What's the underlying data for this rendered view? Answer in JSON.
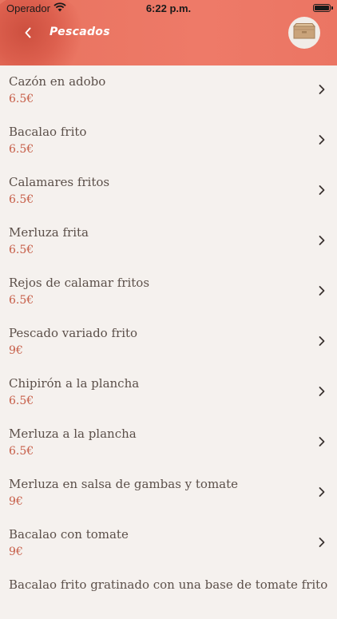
{
  "status_bar": {
    "carrier": "Operador",
    "time": "6:22 p.m."
  },
  "header": {
    "title": "Pescados",
    "back_icon": "chevron-left-icon",
    "cart_icon": "box-icon",
    "background_color": "#ec7663"
  },
  "colors": {
    "price": "#c65d47",
    "text": "#5b4f49",
    "background": "#f5f1ee"
  },
  "items": [
    {
      "name": "Cazón en adobo",
      "price": "6.5€"
    },
    {
      "name": "Bacalao frito",
      "price": "6.5€"
    },
    {
      "name": "Calamares fritos",
      "price": "6.5€"
    },
    {
      "name": "Merluza frita",
      "price": "6.5€"
    },
    {
      "name": "Rejos de calamar fritos",
      "price": "6.5€"
    },
    {
      "name": "Pescado variado frito",
      "price": "9€"
    },
    {
      "name": "Chipirón a la plancha",
      "price": "6.5€"
    },
    {
      "name": "Merluza a la plancha",
      "price": "6.5€"
    },
    {
      "name": "Merluza en salsa de gambas y tomate",
      "price": "9€"
    },
    {
      "name": "Bacalao con tomate",
      "price": "9€"
    },
    {
      "name": "Bacalao frito gratinado con una base de tomate frito",
      "price": ""
    }
  ]
}
